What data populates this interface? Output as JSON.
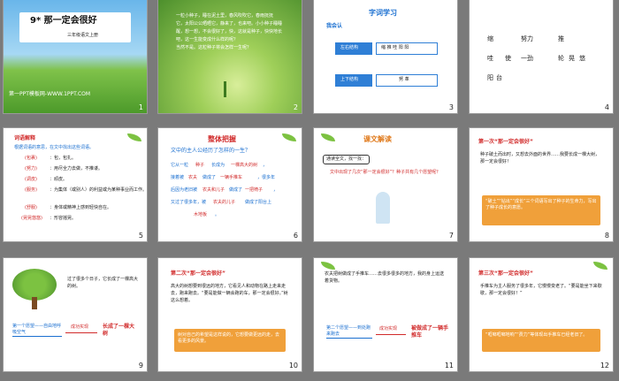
{
  "slides": [
    {
      "num": "1",
      "title": "9* 那一定会很好",
      "subtitle": "三年级语文上册",
      "footer": "第一PPT模板网-WWW.1PPT.COM"
    },
    {
      "num": "2",
      "lines": [
        "一粒小种子，睡在泥土里，春风吹吹它，春雨抚抚",
        "它，太阳公公晒晒它，静来了，也来吧。小小种子睡睡",
        "醒，想一想，不会很好了，快，这就是种子，快快地长",
        "吧，这一生能变成什么样的呢？",
        "当然不是。这粒种子将会怎样一生呢？"
      ]
    },
    {
      "num": "3",
      "title": "字词学习",
      "section": "我会认",
      "rows": [
        {
          "label": "左右结构",
          "chars": "缩 推 哇 阳 阳"
        },
        {
          "label": "上下结构",
          "chars": "努 革"
        }
      ]
    },
    {
      "num": "4",
      "words": [
        "缩",
        "努力",
        "推",
        "哇",
        "使",
        "一劲",
        "轮",
        "晃",
        "悠",
        "阳",
        "台"
      ]
    },
    {
      "num": "5",
      "heading": "词语解释",
      "intro": "根据词语的意思，在文中找出这些词语。",
      "items": [
        {
          "word": "(包裹)",
          "meaning": "：包，包扎。"
        },
        {
          "word": "(努力)",
          "meaning": "：用尽全力去做，不推诿。"
        },
        {
          "word": "(调皮)",
          "meaning": "：顽皮。"
        },
        {
          "word": "(服务)",
          "meaning": "：为集体（或别人）的利益或为某种事业而工作。"
        },
        {
          "word": "(舒服)",
          "meaning": "：身体或精神上感到轻快自在。"
        },
        {
          "word": "(晃晃悠悠)",
          "meaning": "：形容摇晃。"
        }
      ]
    },
    {
      "num": "6",
      "title": "整体把握",
      "question": "文中的主人公经历了怎样的一生？",
      "blanks": [
        "它从一粒",
        "种子",
        "长成为",
        "一棵高大的树",
        "，",
        "接着被",
        "农夫",
        "做成了",
        "一辆手推车",
        "，很多年",
        "后因为老旧被",
        "农夫和儿子",
        "做成了",
        "一把椅子",
        "，",
        "又过了很多年，被",
        "农夫的儿子",
        "做成了阳台上",
        "木地板",
        "。"
      ]
    },
    {
      "num": "7",
      "title": "课文解读",
      "prompt": "通读全文，找一找：",
      "question": "文中出现了几次“那一定会很好”？种子共有几个愿望呢？"
    },
    {
      "num": "8",
      "heading": "第一次“那一定会很好”",
      "body": "种子破土而出时，又想去外面的世界……我要长成一棵大树，那一定会很好！",
      "note": "“破土”“钻出”“成长”三个词语写出了种子的生命力，写出了种子成长的意愿。"
    },
    {
      "num": "9",
      "caption": "过了很多个日子，它长成了一棵高大的树。",
      "left": "第一个愿望——自由地呼吸空气",
      "arrow": "成功实现",
      "right": "长成了一棵大树"
    },
    {
      "num": "10",
      "heading": "第二次“那一定会很好”",
      "body": "高大的树想要到很远的地方，它看见人和动物在路上走来走去，跑来跑去。“要是能做一辆会跑的车，那一定会很好。”树这么想着。",
      "note": "树对自己的希望是这样说的，它想要做更远的走，去看更多的风景。"
    },
    {
      "num": "11",
      "body": "农夫把树做成了手推车……去很多很多的地方，我的身上运送着货物。",
      "left": "第二个愿望——到处跑来跑去",
      "arrow": "成功实现",
      "right": "被做成了一辆手推车"
    },
    {
      "num": "12",
      "heading": "第三次“那一定会很好”",
      "body": "手推车为主人服务了很多年，它慢慢变老了。“要是能坐下来歇歇，那一定会很好！”",
      "note": "“哐啷哐啷地响”“费力”等体现出手推车已经老旧了。"
    }
  ]
}
